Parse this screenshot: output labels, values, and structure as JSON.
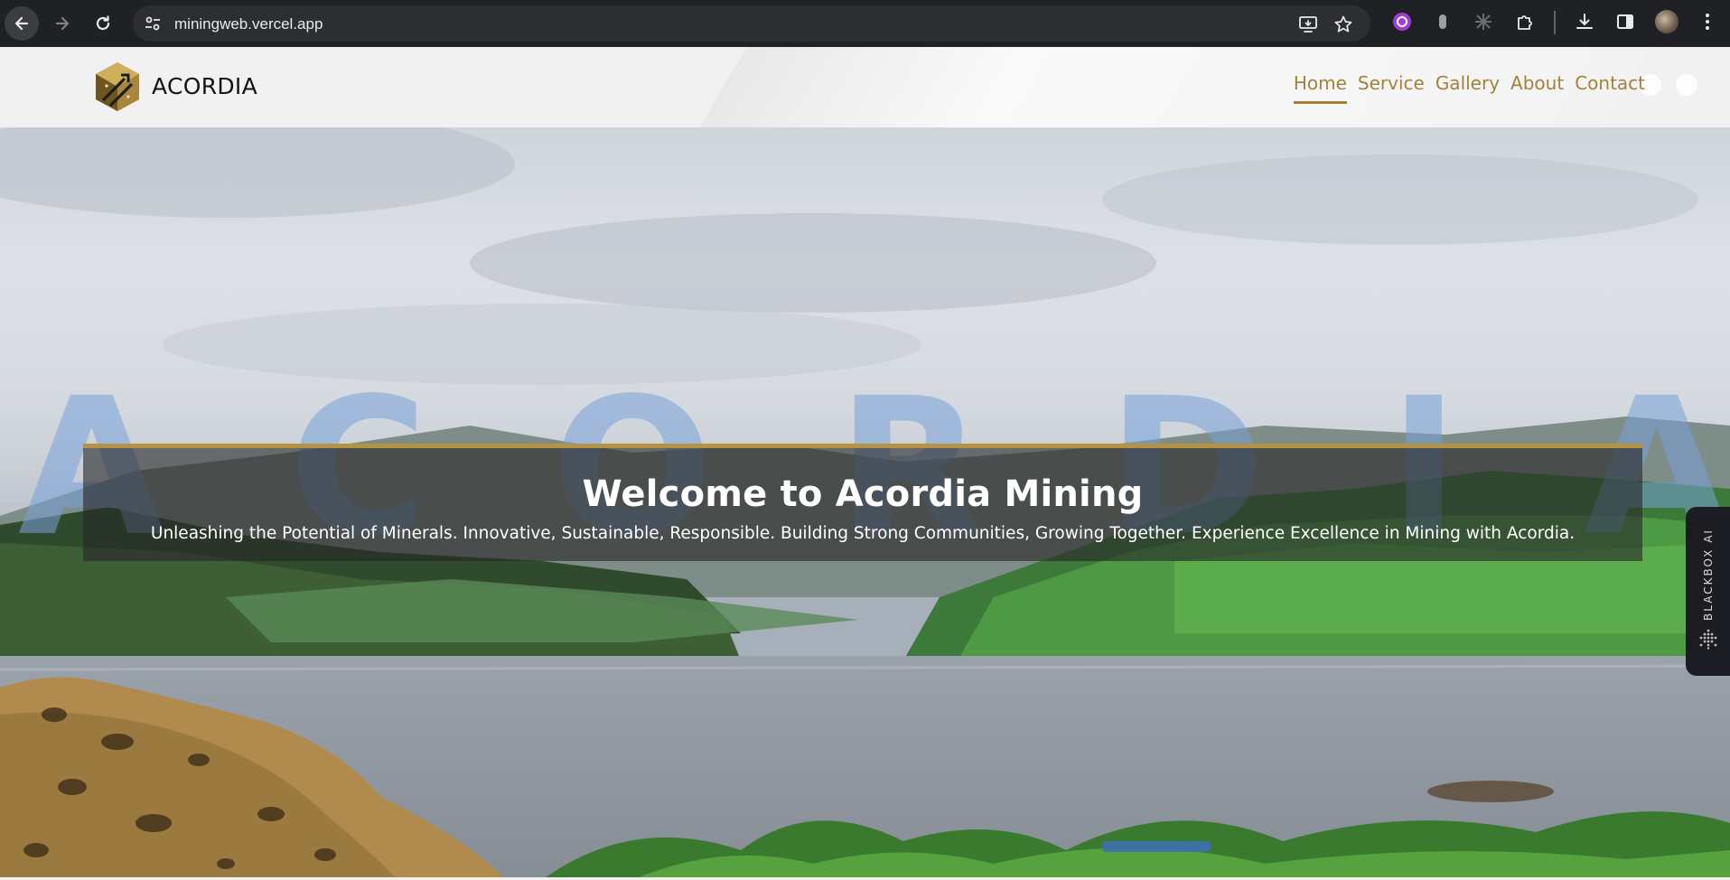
{
  "browser": {
    "url": "miningweb.vercel.app",
    "icons": [
      "back-icon",
      "forward-icon",
      "reload-icon",
      "site-settings-icon",
      "install-app-icon",
      "bookmark-star-icon",
      "extension-icon",
      "extensions-puzzle-icon",
      "download-icon",
      "side-panel-icon",
      "profile-avatar",
      "more-menu-icon"
    ]
  },
  "header": {
    "brand": "ACORDIA",
    "nav": [
      {
        "label": "Home",
        "active": true
      },
      {
        "label": "Service",
        "active": false
      },
      {
        "label": "Gallery",
        "active": false
      },
      {
        "label": "About",
        "active": false
      },
      {
        "label": "Contact",
        "active": false
      }
    ]
  },
  "hero": {
    "watermark_letters": [
      "A",
      "C",
      "O",
      "R",
      "D",
      "I",
      "A"
    ],
    "title": "Welcome to Acordia Mining",
    "subtitle": "Unleashing the Potential of Minerals. Innovative, Sustainable, Responsible. Building Strong Communities, Growing Together. Experience Excellence in Mining with Acordia."
  },
  "widget": {
    "label": "BLACKBOX AI"
  },
  "colors": {
    "accent_gold": "#a2823b",
    "banner_border": "#b49345",
    "chrome_bg": "#202124"
  }
}
